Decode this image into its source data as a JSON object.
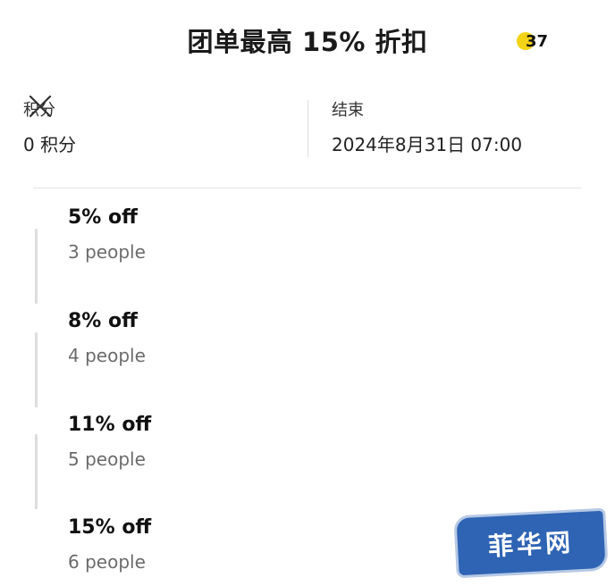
{
  "header": {
    "title": "团单最高 15% 折扣",
    "badge_count": "37",
    "badge_color": "#f3d316"
  },
  "close_icon": "close-icon",
  "info": {
    "points_label": "积分",
    "points_value": "0 积分",
    "end_label": "结束",
    "end_value": "2024年8月31日 07:00"
  },
  "tiers": [
    {
      "discount": "5% off",
      "people": "3 people"
    },
    {
      "discount": "8% off",
      "people": "4 people"
    },
    {
      "discount": "11% off",
      "people": "5 people"
    },
    {
      "discount": "15% off",
      "people": "6 people"
    }
  ],
  "watermark": {
    "text": "菲华网",
    "color": "#2f64b4"
  }
}
